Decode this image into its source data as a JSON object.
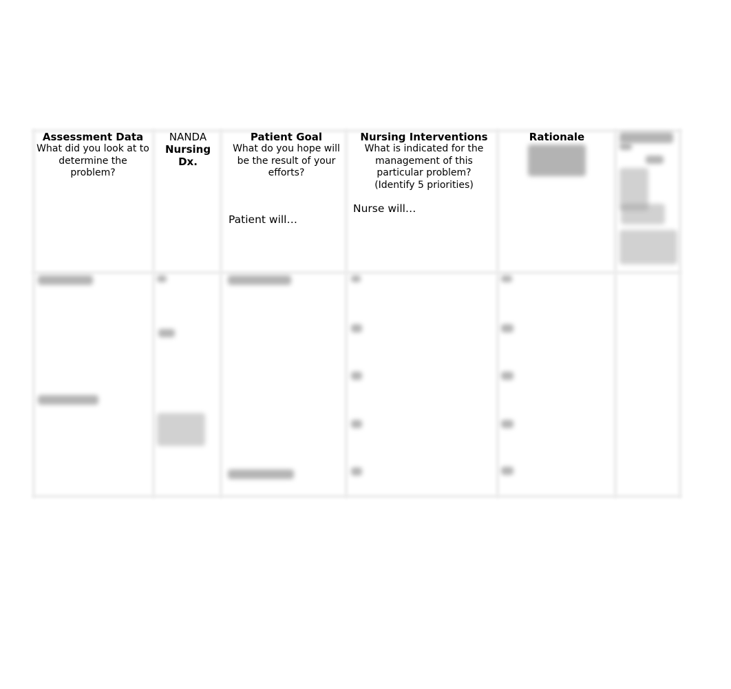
{
  "document": {
    "table": {
      "columns": [
        {
          "title": "Assessment Data",
          "subtitle": "What did you look at to determine the problem?"
        },
        {
          "title_prefix": "NANDA",
          "title": "Nursing Dx."
        },
        {
          "title": "Patient Goal",
          "subtitle": "What do you hope will be the result of your efforts?",
          "lead": "Patient will…"
        },
        {
          "title": "Nursing Interventions",
          "subtitle": "What is indicated for the management of this particular problem?",
          "note": "(Identify 5 priorities)",
          "lead": "Nurse will…"
        },
        {
          "title": "Rationale",
          "subtitle": "[obscured]"
        },
        {
          "title": "[obscured]"
        }
      ],
      "body_row": {
        "content": "[obscured]"
      }
    }
  }
}
